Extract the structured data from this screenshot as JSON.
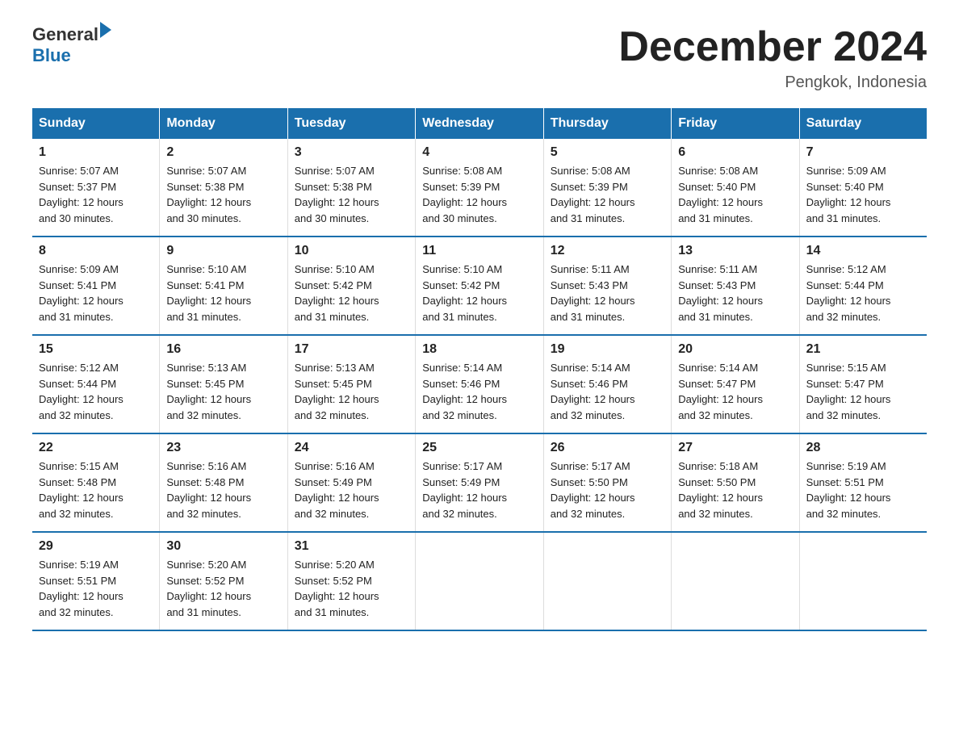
{
  "logo": {
    "general": "General",
    "blue": "Blue"
  },
  "title": "December 2024",
  "location": "Pengkok, Indonesia",
  "days_header": [
    "Sunday",
    "Monday",
    "Tuesday",
    "Wednesday",
    "Thursday",
    "Friday",
    "Saturday"
  ],
  "weeks": [
    [
      {
        "day": "1",
        "sunrise": "5:07 AM",
        "sunset": "5:37 PM",
        "daylight": "12 hours and 30 minutes."
      },
      {
        "day": "2",
        "sunrise": "5:07 AM",
        "sunset": "5:38 PM",
        "daylight": "12 hours and 30 minutes."
      },
      {
        "day": "3",
        "sunrise": "5:07 AM",
        "sunset": "5:38 PM",
        "daylight": "12 hours and 30 minutes."
      },
      {
        "day": "4",
        "sunrise": "5:08 AM",
        "sunset": "5:39 PM",
        "daylight": "12 hours and 30 minutes."
      },
      {
        "day": "5",
        "sunrise": "5:08 AM",
        "sunset": "5:39 PM",
        "daylight": "12 hours and 31 minutes."
      },
      {
        "day": "6",
        "sunrise": "5:08 AM",
        "sunset": "5:40 PM",
        "daylight": "12 hours and 31 minutes."
      },
      {
        "day": "7",
        "sunrise": "5:09 AM",
        "sunset": "5:40 PM",
        "daylight": "12 hours and 31 minutes."
      }
    ],
    [
      {
        "day": "8",
        "sunrise": "5:09 AM",
        "sunset": "5:41 PM",
        "daylight": "12 hours and 31 minutes."
      },
      {
        "day": "9",
        "sunrise": "5:10 AM",
        "sunset": "5:41 PM",
        "daylight": "12 hours and 31 minutes."
      },
      {
        "day": "10",
        "sunrise": "5:10 AM",
        "sunset": "5:42 PM",
        "daylight": "12 hours and 31 minutes."
      },
      {
        "day": "11",
        "sunrise": "5:10 AM",
        "sunset": "5:42 PM",
        "daylight": "12 hours and 31 minutes."
      },
      {
        "day": "12",
        "sunrise": "5:11 AM",
        "sunset": "5:43 PM",
        "daylight": "12 hours and 31 minutes."
      },
      {
        "day": "13",
        "sunrise": "5:11 AM",
        "sunset": "5:43 PM",
        "daylight": "12 hours and 31 minutes."
      },
      {
        "day": "14",
        "sunrise": "5:12 AM",
        "sunset": "5:44 PM",
        "daylight": "12 hours and 32 minutes."
      }
    ],
    [
      {
        "day": "15",
        "sunrise": "5:12 AM",
        "sunset": "5:44 PM",
        "daylight": "12 hours and 32 minutes."
      },
      {
        "day": "16",
        "sunrise": "5:13 AM",
        "sunset": "5:45 PM",
        "daylight": "12 hours and 32 minutes."
      },
      {
        "day": "17",
        "sunrise": "5:13 AM",
        "sunset": "5:45 PM",
        "daylight": "12 hours and 32 minutes."
      },
      {
        "day": "18",
        "sunrise": "5:14 AM",
        "sunset": "5:46 PM",
        "daylight": "12 hours and 32 minutes."
      },
      {
        "day": "19",
        "sunrise": "5:14 AM",
        "sunset": "5:46 PM",
        "daylight": "12 hours and 32 minutes."
      },
      {
        "day": "20",
        "sunrise": "5:14 AM",
        "sunset": "5:47 PM",
        "daylight": "12 hours and 32 minutes."
      },
      {
        "day": "21",
        "sunrise": "5:15 AM",
        "sunset": "5:47 PM",
        "daylight": "12 hours and 32 minutes."
      }
    ],
    [
      {
        "day": "22",
        "sunrise": "5:15 AM",
        "sunset": "5:48 PM",
        "daylight": "12 hours and 32 minutes."
      },
      {
        "day": "23",
        "sunrise": "5:16 AM",
        "sunset": "5:48 PM",
        "daylight": "12 hours and 32 minutes."
      },
      {
        "day": "24",
        "sunrise": "5:16 AM",
        "sunset": "5:49 PM",
        "daylight": "12 hours and 32 minutes."
      },
      {
        "day": "25",
        "sunrise": "5:17 AM",
        "sunset": "5:49 PM",
        "daylight": "12 hours and 32 minutes."
      },
      {
        "day": "26",
        "sunrise": "5:17 AM",
        "sunset": "5:50 PM",
        "daylight": "12 hours and 32 minutes."
      },
      {
        "day": "27",
        "sunrise": "5:18 AM",
        "sunset": "5:50 PM",
        "daylight": "12 hours and 32 minutes."
      },
      {
        "day": "28",
        "sunrise": "5:19 AM",
        "sunset": "5:51 PM",
        "daylight": "12 hours and 32 minutes."
      }
    ],
    [
      {
        "day": "29",
        "sunrise": "5:19 AM",
        "sunset": "5:51 PM",
        "daylight": "12 hours and 32 minutes."
      },
      {
        "day": "30",
        "sunrise": "5:20 AM",
        "sunset": "5:52 PM",
        "daylight": "12 hours and 31 minutes."
      },
      {
        "day": "31",
        "sunrise": "5:20 AM",
        "sunset": "5:52 PM",
        "daylight": "12 hours and 31 minutes."
      },
      null,
      null,
      null,
      null
    ]
  ],
  "labels": {
    "sunrise": "Sunrise:",
    "sunset": "Sunset:",
    "daylight": "Daylight:"
  }
}
